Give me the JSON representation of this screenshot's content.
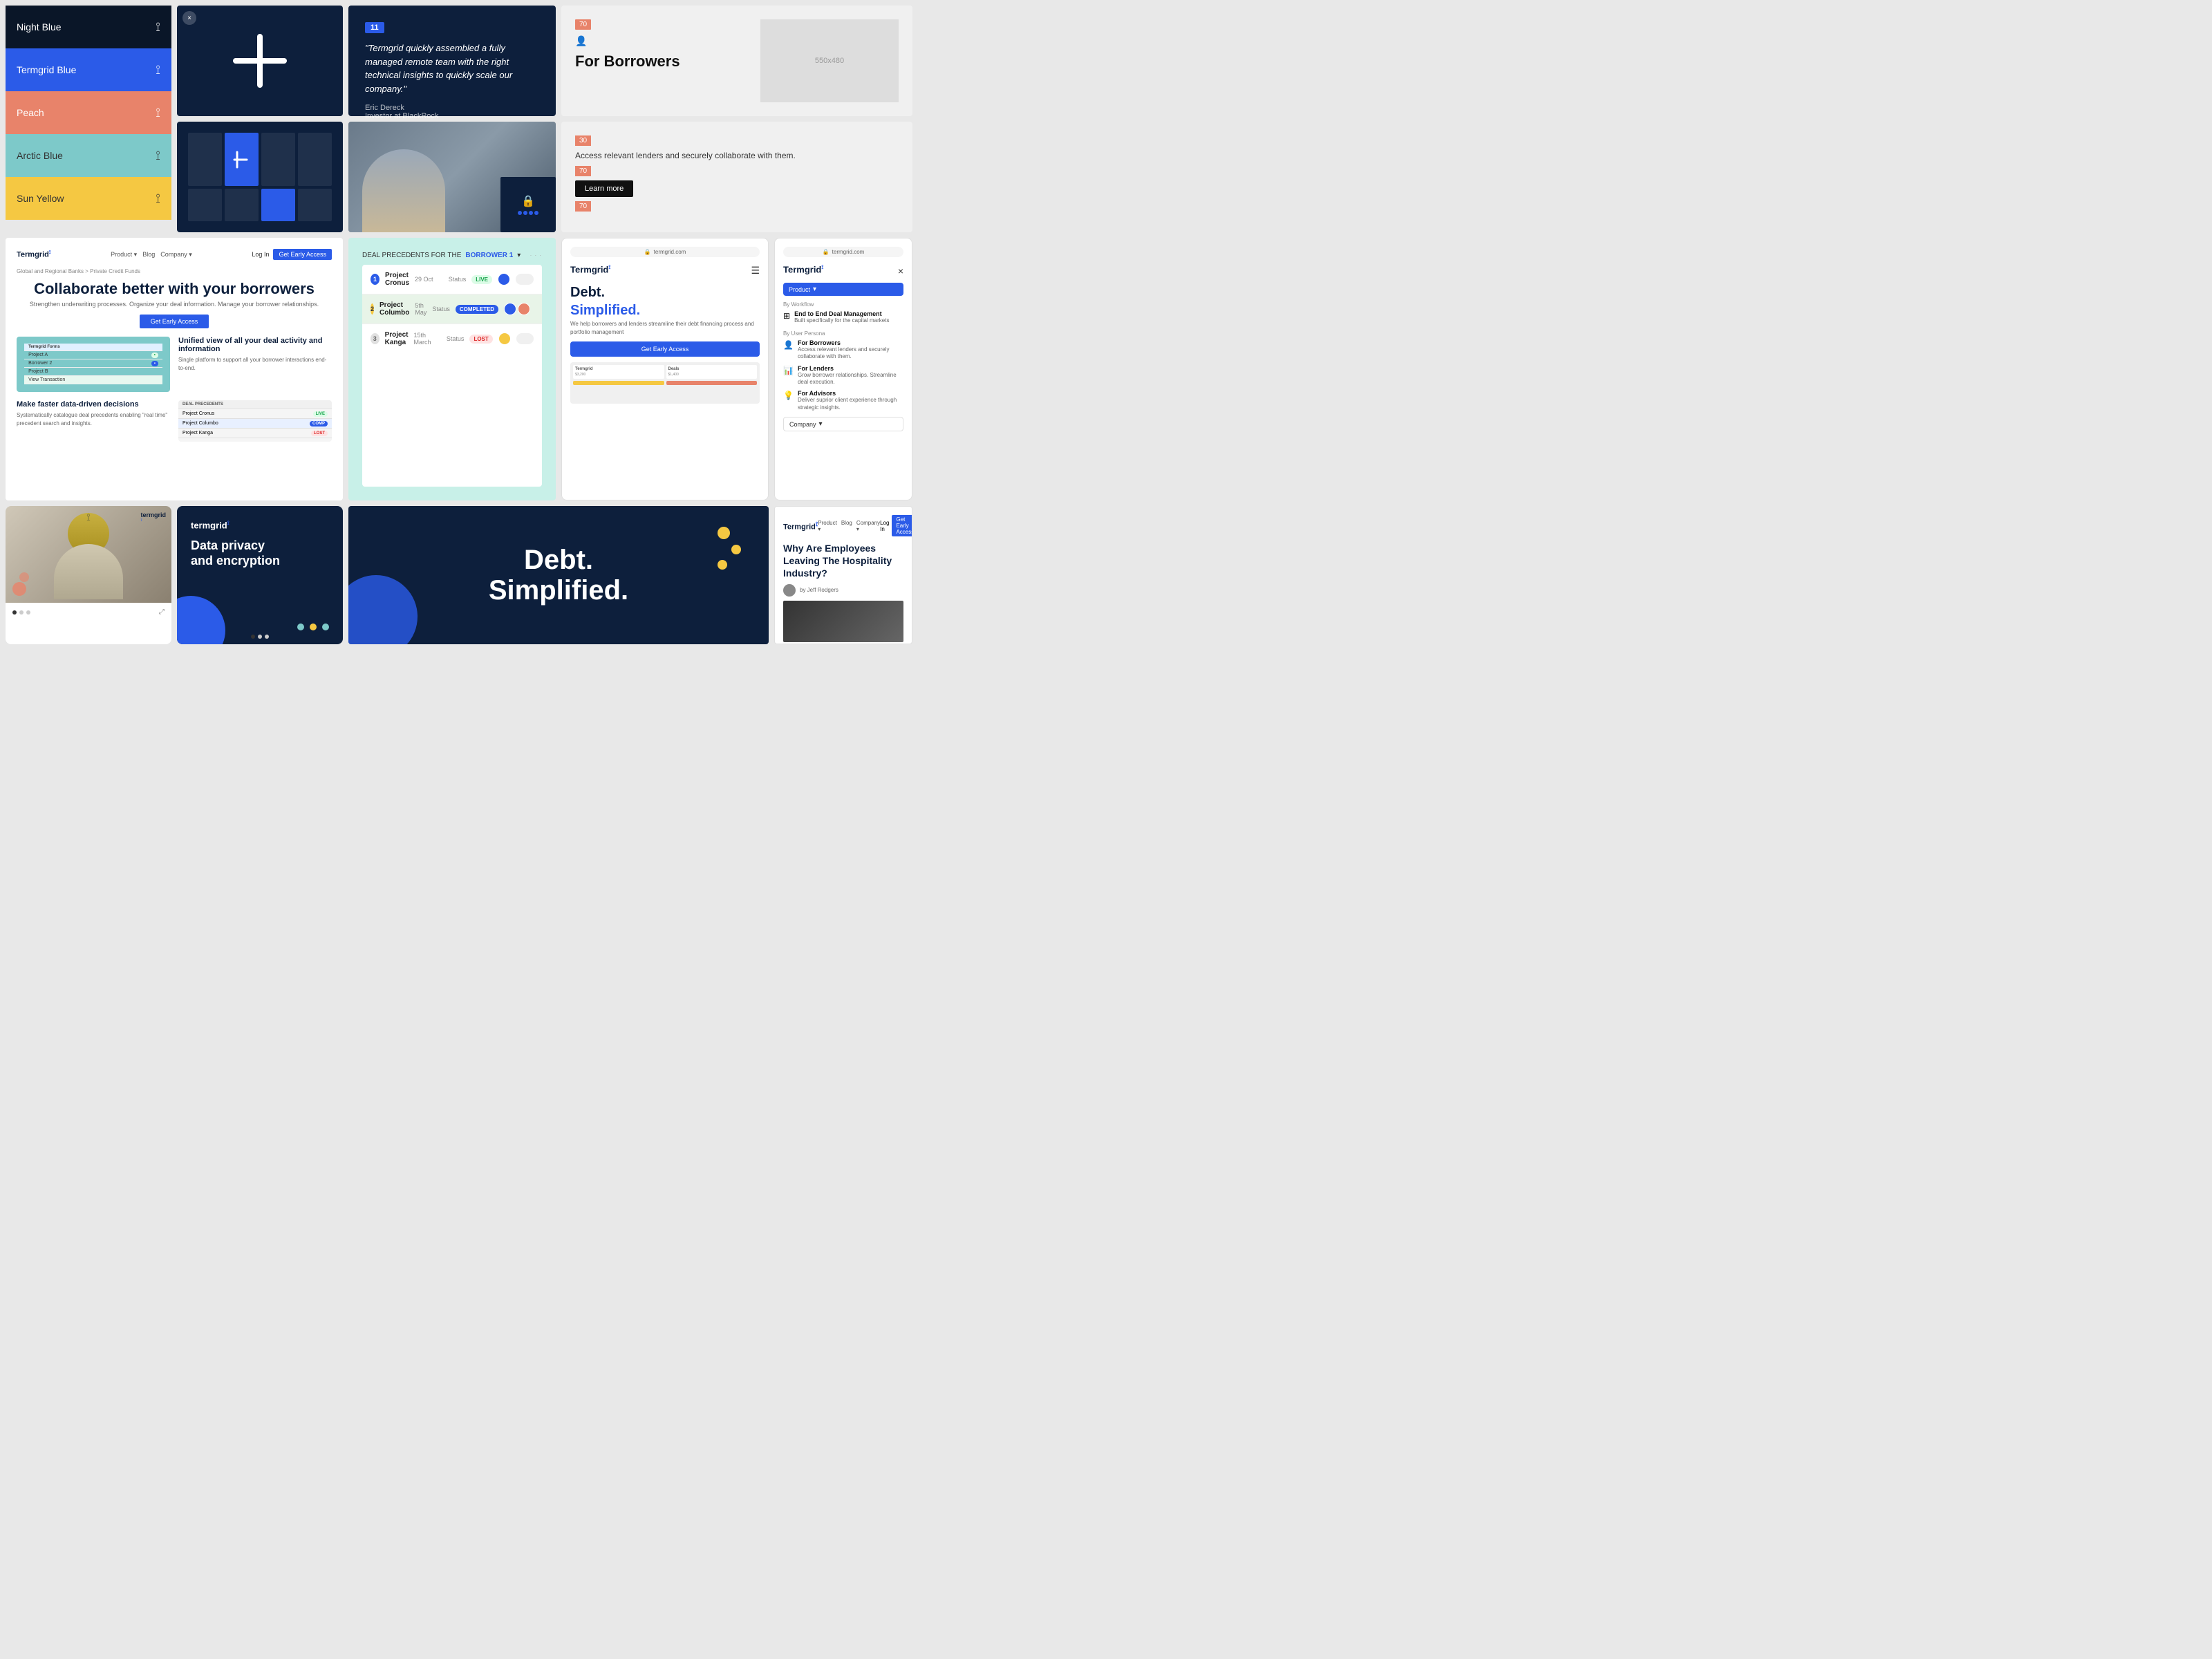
{
  "swatches": [
    {
      "id": "night-blue",
      "label": "Night Blue",
      "class": "night-blue",
      "icon": "⟟"
    },
    {
      "id": "termgrid-blue",
      "label": "Termgrid Blue",
      "class": "termgrid-blue",
      "icon": "⟟"
    },
    {
      "id": "peach",
      "label": "Peach",
      "class": "peach",
      "icon": "⟟"
    },
    {
      "id": "arctic-blue",
      "label": "Arctic Blue",
      "class": "arctic-blue",
      "icon": "⟟"
    },
    {
      "id": "sun-yellow",
      "label": "Sun Yellow",
      "class": "sun-yellow",
      "icon": "⟟"
    }
  ],
  "quote": {
    "num": "11",
    "text": "\"Termgrid quickly assembled a fully managed remote team with the right technical insights to quickly scale our company.\"",
    "author": "Eric Dereck",
    "role": "Investor at BlackRock"
  },
  "borrower": {
    "tag": "70",
    "title": "For Borrowers",
    "placeholder": "550x480",
    "access_tag": "30",
    "access_text": "Access relevant lenders and securely collaborate with them.",
    "learn_more": "Learn more"
  },
  "website": {
    "logo": "Termgrid",
    "nav_product": "Product ▾",
    "nav_blog": "Blog",
    "nav_company": "Company ▾",
    "nav_login": "Log In",
    "nav_cta": "Get Early Access",
    "breadcrumb": "Global and Regional Banks > Private Credit Funds",
    "headline": "Collaborate better with your borrowers",
    "subtext": "Strengthen underwriting processes. Organize your deal information. Manage your borrower relationships.",
    "cta": "Get Early Access",
    "feature1_title": "Unified view of all your deal activity and information",
    "feature1_text": "Single platform to support all your borrower interactions end-to-end.",
    "feature2_title": "Make faster data-driven decisions",
    "feature2_text": "Systematically catalogue deal precedents enabling \"real time\" precedent search and insights."
  },
  "deal_precedents": {
    "header": "DEAL PRECEDENTS FOR THE",
    "borrower": "BORROWER 1",
    "projects": [
      {
        "num": "1",
        "name": "Project Cronus",
        "date": "29 Oct",
        "status": "LIVE",
        "type": "live"
      },
      {
        "num": "2",
        "name": "Project Columbo",
        "date": "5th May",
        "status": "COMPLETED",
        "type": "completed"
      },
      {
        "num": "3",
        "name": "Project Kanga",
        "date": "15th March",
        "status": "LOST",
        "type": "lost"
      }
    ]
  },
  "mobile1": {
    "url": "termgrid.com",
    "logo": "Termgrid",
    "headline_line1": "Debt.",
    "headline_line2": "Simplified.",
    "subtext": "We help borrowers and lenders streamline their debt financing process and portfolio management",
    "cta": "Get Early Access"
  },
  "mobile2": {
    "url": "termgrid.com",
    "logo": "Termgrid",
    "product_label": "Product",
    "sections": {
      "workflow": {
        "title": "By Workflow",
        "item1_title": "End to End Deal Management",
        "item1_text": "Built specifically for the capital markets"
      },
      "persona": {
        "title": "By User Persona",
        "item1_title": "For Borrowers",
        "item1_text": "Access relevant lenders and securely collaborate with them.",
        "item2_title": "For Lenders",
        "item2_text": "Grow borrower relationships. Streamline deal execution.",
        "item3_title": "For Advisors",
        "item3_text": "Deliver suprior client experience through strategic insights."
      }
    },
    "company_label": "Company"
  },
  "hero": {
    "line1": "Debt.",
    "line2": "Simplified."
  },
  "social_card2": {
    "logo": "termgrid",
    "headline_line1": "Data privacy",
    "headline_line2": "and encryption"
  },
  "blog": {
    "logo": "Termgrid",
    "nav_product": "Product ▾",
    "nav_blog": "Blog",
    "nav_company": "Company ▾",
    "nav_login": "Log In",
    "nav_cta": "Get Early Access",
    "headline": "Why Are Employees Leaving The Hospitality Industry?",
    "author": "by Jeff Rodgers"
  },
  "colors": {
    "night_blue": "#0a1628",
    "termgrid_blue": "#2b5be8",
    "peach": "#e8836a",
    "arctic_blue": "#7dc9c9",
    "sun_yellow": "#f5c842"
  }
}
